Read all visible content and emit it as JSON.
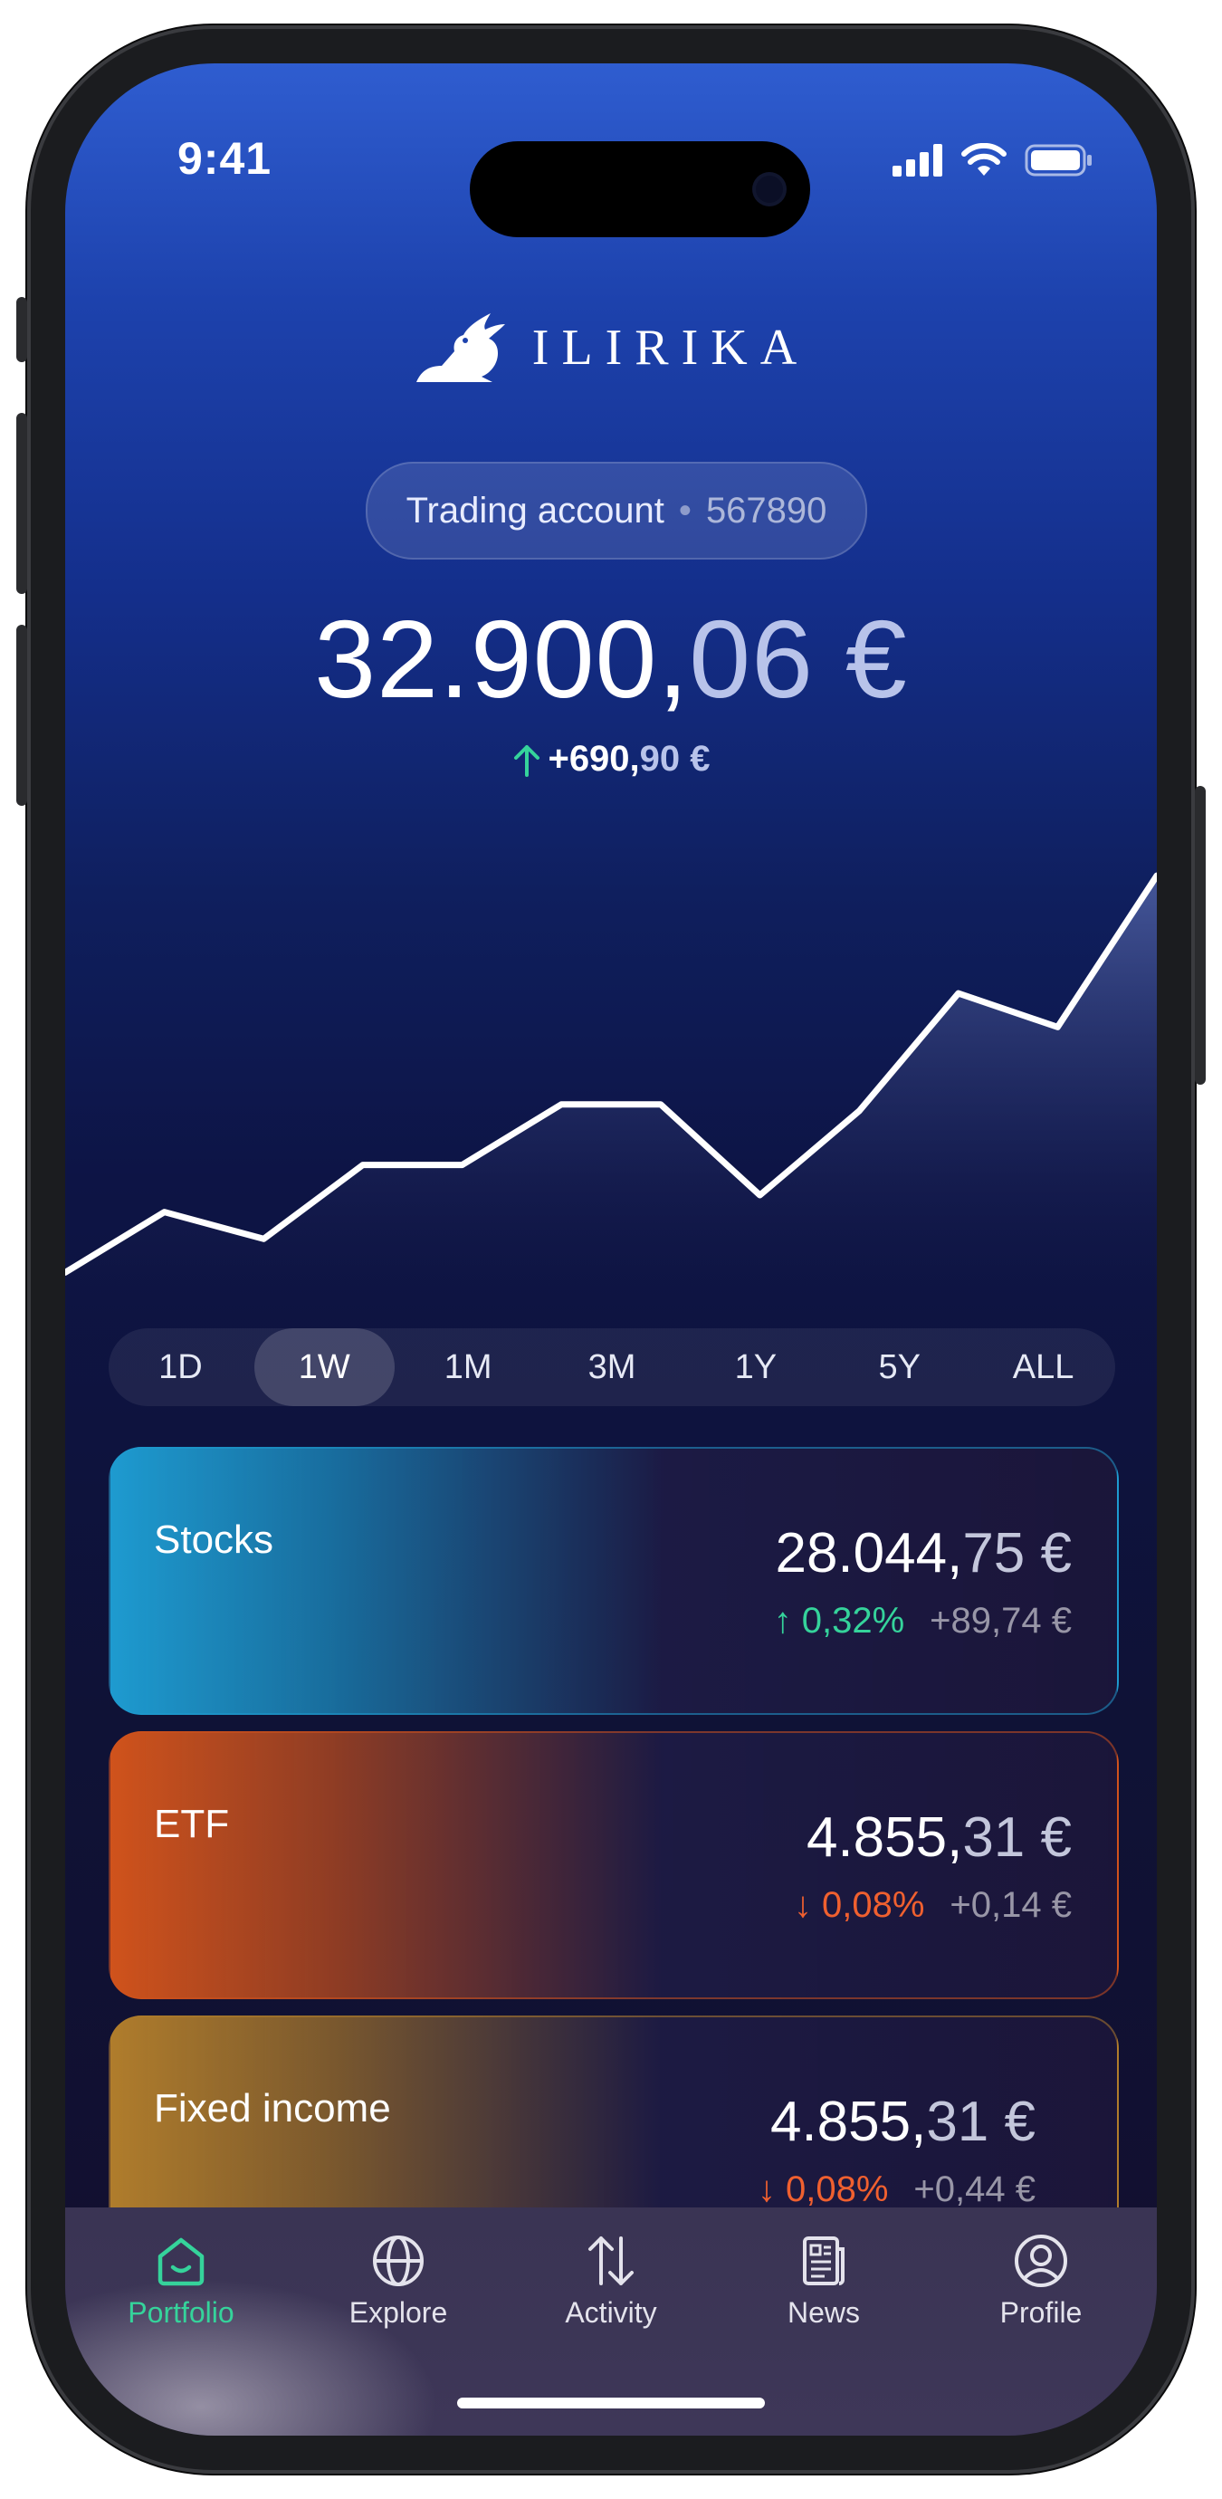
{
  "status_bar": {
    "time": "9:41"
  },
  "brand": {
    "name": "ILIRIKA"
  },
  "account": {
    "label": "Trading account",
    "separator": "•",
    "number": "567890"
  },
  "balance": {
    "integer_part": "32.900,",
    "decimal_part": "06 €"
  },
  "change": {
    "direction": "up",
    "value_main": "+690,",
    "value_decimal": "90 €"
  },
  "chart_data": {
    "type": "area",
    "x": [
      0,
      1,
      2,
      3,
      4,
      5,
      6,
      7,
      8,
      9,
      10,
      11
    ],
    "values": [
      12,
      30,
      22,
      44,
      44,
      62,
      62,
      35,
      60,
      95,
      85,
      130
    ],
    "ylim": [
      0,
      140
    ],
    "grid": false
  },
  "periods": [
    {
      "label": "1D",
      "active": false
    },
    {
      "label": "1W",
      "active": true
    },
    {
      "label": "1M",
      "active": false
    },
    {
      "label": "3M",
      "active": false
    },
    {
      "label": "1Y",
      "active": false
    },
    {
      "label": "5Y",
      "active": false
    },
    {
      "label": "ALL",
      "active": false
    }
  ],
  "assets": [
    {
      "name": "Stocks",
      "amount_main": "28.044,",
      "amount_decimal": "75 €",
      "pct": "0,32%",
      "direction": "up",
      "abs": "+89,74 €",
      "accent": "#1e9bd0"
    },
    {
      "name": "ETF",
      "amount_main": "4.855,",
      "amount_decimal": "31 €",
      "pct": "0,08%",
      "direction": "down",
      "abs": "+0,14 €",
      "accent": "#d0531c"
    },
    {
      "name": "Fixed income",
      "amount_main": "4.855,",
      "amount_decimal": "31 €",
      "pct": "0,08%",
      "direction": "down",
      "abs": "+0,44 €",
      "accent": "#b07d2c"
    }
  ],
  "tabs": [
    {
      "label": "Portfolio",
      "icon": "home-icon",
      "active": true
    },
    {
      "label": "Explore",
      "icon": "globe-icon",
      "active": false
    },
    {
      "label": "Activity",
      "icon": "transfer-arrows-icon",
      "active": false
    },
    {
      "label": "News",
      "icon": "newspaper-icon",
      "active": false
    },
    {
      "label": "Profile",
      "icon": "user-circle-icon",
      "active": false
    }
  ],
  "colors": {
    "up": "#35d39b",
    "down": "#f0602f",
    "accent_active": "#35d39b"
  }
}
